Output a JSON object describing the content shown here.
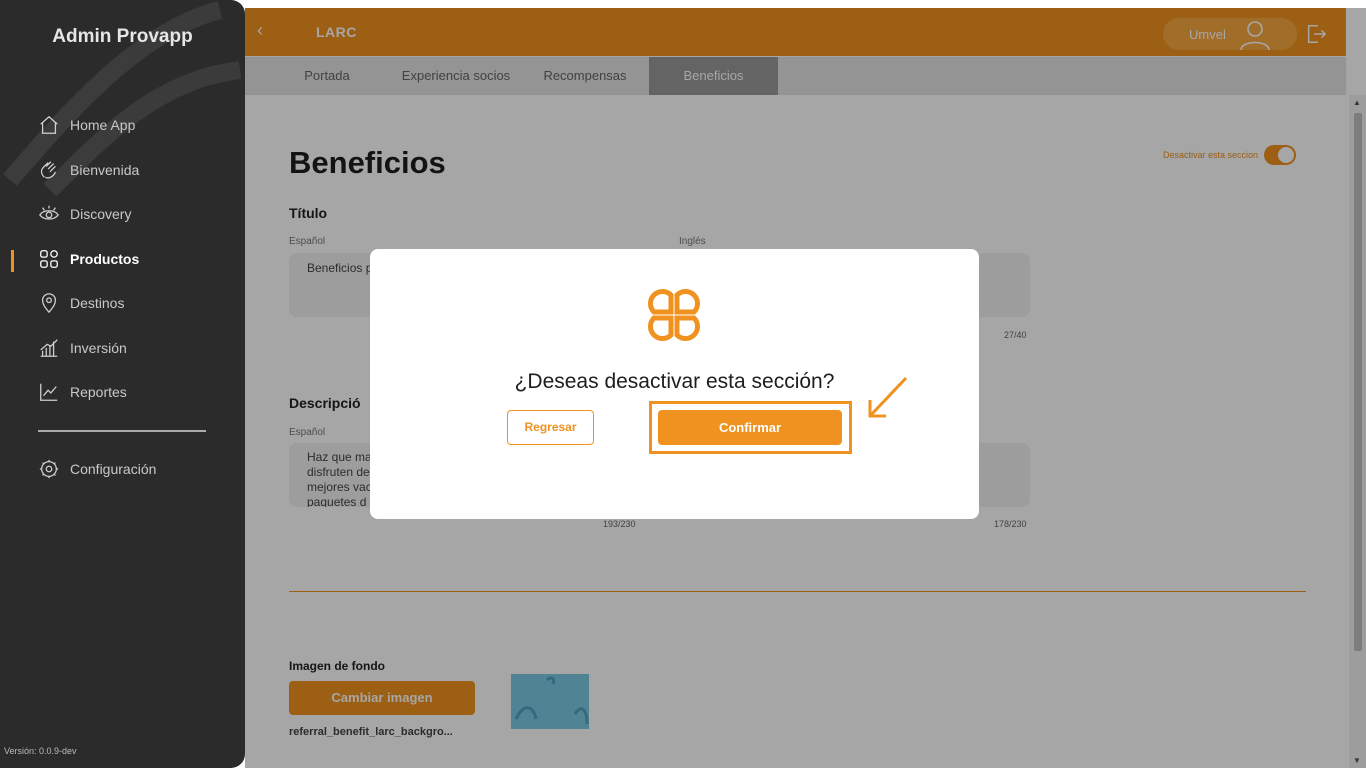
{
  "sidebar": {
    "brand": "Admin Provapp",
    "items": [
      {
        "label": "Home App",
        "icon": "home-icon"
      },
      {
        "label": "Bienvenida",
        "icon": "hand-wave-icon"
      },
      {
        "label": "Discovery",
        "icon": "eye-icon"
      },
      {
        "label": "Productos",
        "icon": "grid-icon"
      },
      {
        "label": "Destinos",
        "icon": "map-pin-icon"
      },
      {
        "label": "Inversión",
        "icon": "bar-chart-icon"
      },
      {
        "label": "Reportes",
        "icon": "line-chart-icon"
      },
      {
        "label": "Configuración",
        "icon": "gear-icon"
      }
    ],
    "active_item": "Productos",
    "version": "Versión: 0.0.9-dev"
  },
  "header": {
    "title": "LARC",
    "user_name": "Umvel"
  },
  "tabs": [
    {
      "label": "Portada"
    },
    {
      "label": "Experiencia socios"
    },
    {
      "label": "Recompensas"
    },
    {
      "label": "Beneficios"
    }
  ],
  "active_tab": "Beneficios",
  "page": {
    "title": "Beneficios",
    "toggle_label": "Desactivar esta seccion",
    "titulo_section": "Título",
    "lang_es": "Español",
    "lang_en": "Inglés",
    "titulo_es_value": "Beneficios p",
    "titulo_en_counter": "27/40",
    "descripcion_section": "Descripció",
    "descripcion_es_value": "Haz que ma\ndisfruten de\nmejores vac\npaquetes d",
    "descripcion_es_counter": "193/230",
    "descripcion_en_counter": "178/230",
    "image_label": "Imagen de fondo",
    "change_image_button": "Cambiar imagen",
    "filename": "referral_benefit_larc_backgro..."
  },
  "modal": {
    "question": "¿Deseas desactivar esta sección?",
    "back_button": "Regresar",
    "confirm_button": "Confirmar"
  },
  "colors": {
    "accent": "#f0921f",
    "sidebar_bg": "#2b2b2b"
  }
}
